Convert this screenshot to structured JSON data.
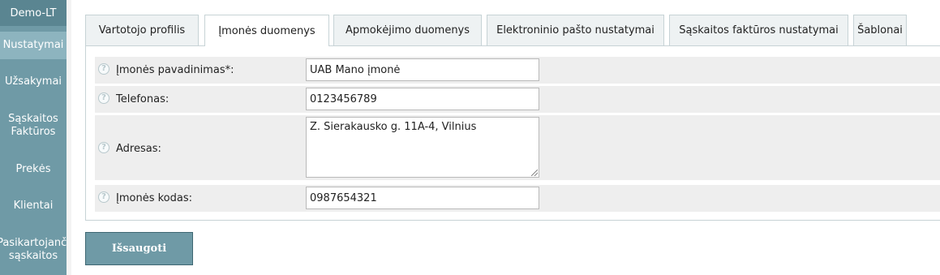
{
  "sidebar": {
    "brand": "Demo-LT",
    "items": [
      {
        "label": "Nustatymai",
        "active": true
      },
      {
        "label": "Užsakymai",
        "active": false
      },
      {
        "label": "Sąskaitos\nFaktūros",
        "active": false
      },
      {
        "label": "Prekės",
        "active": false
      },
      {
        "label": "Klientai",
        "active": false
      },
      {
        "label": "Pasikartojanči\nsąskaitos",
        "active": false
      }
    ]
  },
  "tabs": [
    {
      "label": "Vartotojo profilis",
      "active": false
    },
    {
      "label": "Įmonės duomenys",
      "active": true
    },
    {
      "label": "Apmokėjimo duomenys",
      "active": false
    },
    {
      "label": "Elektroninio pašto nustatymai",
      "active": false
    },
    {
      "label": "Sąskaitos faktūros nustatymai",
      "active": false
    },
    {
      "label": "Šablonai",
      "active": false
    }
  ],
  "form": {
    "company_name_label": "Įmonės pavadinimas*:",
    "company_name_value": "UAB Mano įmonė",
    "phone_label": "Telefonas:",
    "phone_value": "0123456789",
    "address_label": "Adresas:",
    "address_value": "Z. Sierakausko g. 11A-4, Vilnius",
    "company_code_label": "Įmonės kodas:",
    "company_code_value": "0987654321",
    "help_glyph": "?"
  },
  "actions": {
    "save_label": "Išsaugoti"
  },
  "colors": {
    "sidebar": "#6f9aa6",
    "sidebar_active": "#8db4bf",
    "button": "#6f9aa6"
  }
}
